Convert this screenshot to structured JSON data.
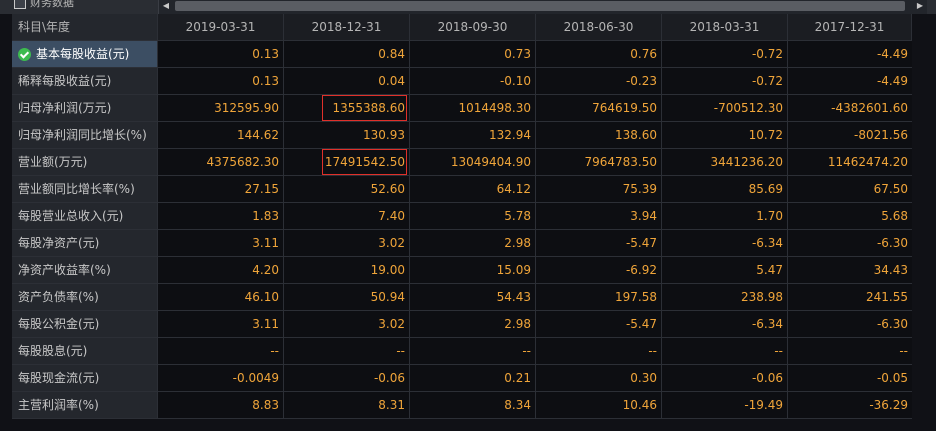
{
  "header": {
    "partial_title": "财务数据",
    "corner_label": "科目\\年度",
    "columns": [
      "2019-03-31",
      "2018-12-31",
      "2018-09-30",
      "2018-06-30",
      "2018-03-31",
      "2017-12-31"
    ]
  },
  "rows": [
    {
      "label": "基本每股收益(元)",
      "values": [
        "0.13",
        "0.84",
        "0.73",
        "0.76",
        "-0.72",
        "-4.49"
      ]
    },
    {
      "label": "稀释每股收益(元)",
      "values": [
        "0.13",
        "0.04",
        "-0.10",
        "-0.23",
        "-0.72",
        "-4.49"
      ]
    },
    {
      "label": "归母净利润(万元)",
      "values": [
        "312595.90",
        "1355388.60",
        "1014498.30",
        "764619.50",
        "-700512.30",
        "-4382601.60"
      ]
    },
    {
      "label": "归母净利润同比增长(%)",
      "values": [
        "144.62",
        "130.93",
        "132.94",
        "138.60",
        "10.72",
        "-8021.56"
      ]
    },
    {
      "label": "营业额(万元)",
      "values": [
        "4375682.30",
        "17491542.50",
        "13049404.90",
        "7964783.50",
        "3441236.20",
        "11462474.20"
      ]
    },
    {
      "label": "营业额同比增长率(%)",
      "values": [
        "27.15",
        "52.60",
        "64.12",
        "75.39",
        "85.69",
        "67.50"
      ]
    },
    {
      "label": "每股营业总收入(元)",
      "values": [
        "1.83",
        "7.40",
        "5.78",
        "3.94",
        "1.70",
        "5.68"
      ]
    },
    {
      "label": "每股净资产(元)",
      "values": [
        "3.11",
        "3.02",
        "2.98",
        "-5.47",
        "-6.34",
        "-6.30"
      ]
    },
    {
      "label": "净资产收益率(%)",
      "values": [
        "4.20",
        "19.00",
        "15.09",
        "-6.92",
        "5.47",
        "34.43"
      ]
    },
    {
      "label": "资产负债率(%)",
      "values": [
        "46.10",
        "50.94",
        "54.43",
        "197.58",
        "238.98",
        "241.55"
      ]
    },
    {
      "label": "每股公积金(元)",
      "values": [
        "3.11",
        "3.02",
        "2.98",
        "-5.47",
        "-6.34",
        "-6.30"
      ]
    },
    {
      "label": "每股股息(元)",
      "values": [
        "--",
        "--",
        "--",
        "--",
        "--",
        "--"
      ]
    },
    {
      "label": "每股现金流(元)",
      "values": [
        "-0.0049",
        "-0.06",
        "0.21",
        "0.30",
        "-0.06",
        "-0.05"
      ]
    },
    {
      "label": "主营利润率(%)",
      "values": [
        "8.83",
        "8.31",
        "8.34",
        "10.46",
        "-19.49",
        "-36.29"
      ]
    }
  ],
  "selected_row": 0,
  "highlighted_cells": [
    {
      "row": 2,
      "col": 1
    },
    {
      "row": 4,
      "col": 1
    }
  ],
  "colors": {
    "value_text": "#f0a53a",
    "label_text": "#c8c8c8",
    "highlight_border": "#e0302a",
    "selected_row_bg": "#3c4e63",
    "check_icon": "#3dbb4f"
  }
}
